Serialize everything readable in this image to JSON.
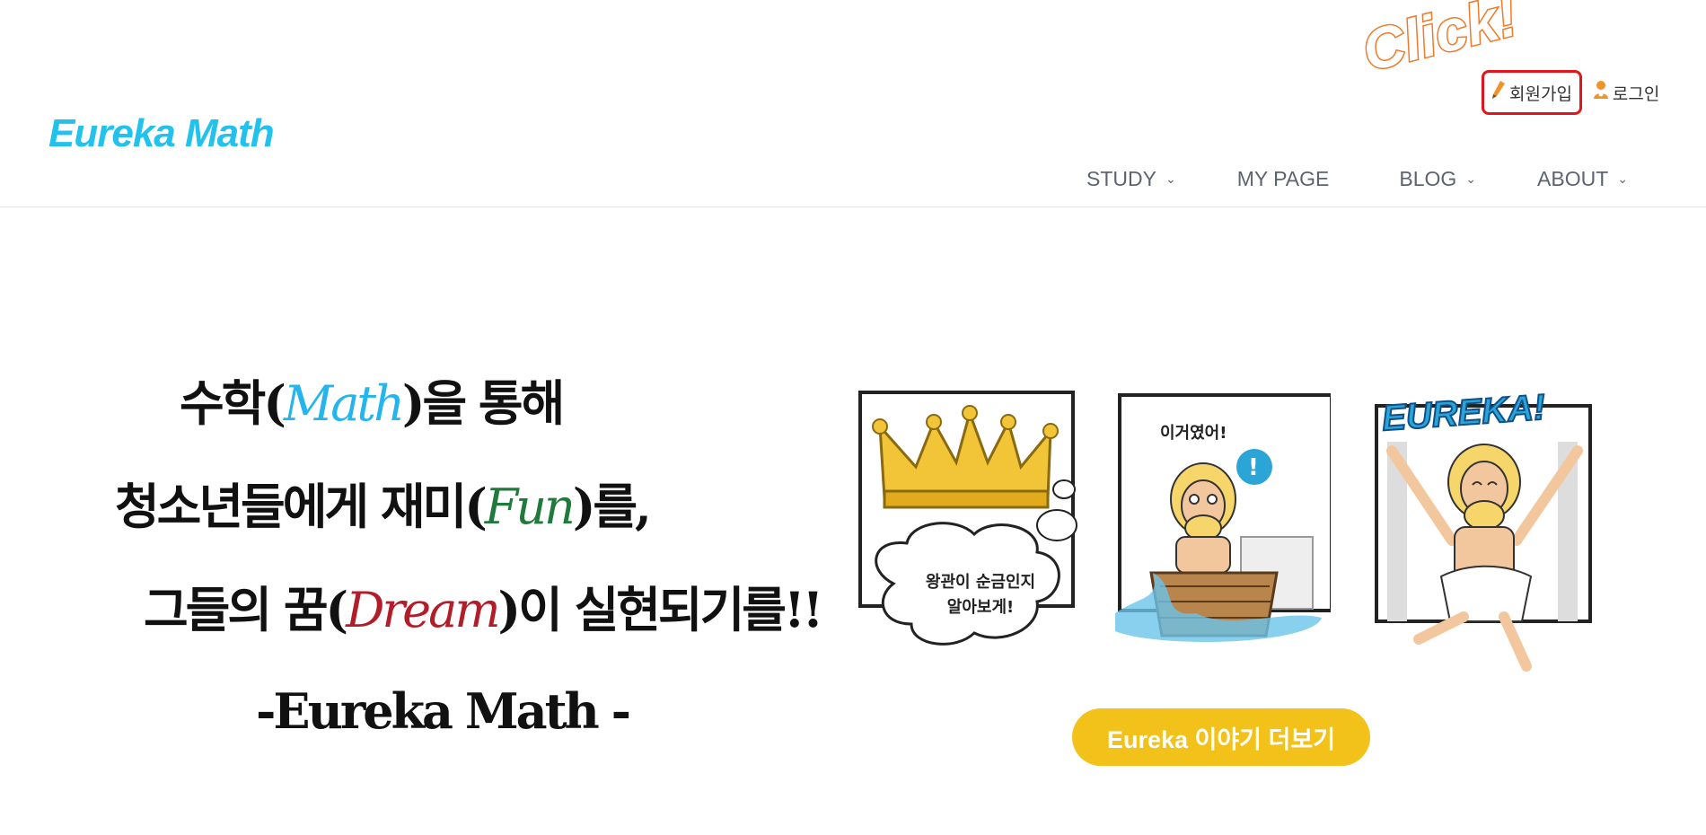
{
  "header": {
    "logo": "Eureka Math",
    "annotation": "Click!",
    "top_links": [
      {
        "label": "회원가입",
        "icon": "pencil-icon"
      },
      {
        "label": "로그인",
        "icon": "user-icon"
      }
    ],
    "nav": [
      {
        "label": "STUDY",
        "has_dropdown": true
      },
      {
        "label": "MY PAGE",
        "has_dropdown": false
      },
      {
        "label": "BLOG",
        "has_dropdown": true
      },
      {
        "label": "ABOUT",
        "has_dropdown": true
      }
    ],
    "chevron": "⌄"
  },
  "hero": {
    "line1": {
      "a": "수학(",
      "b": "Math",
      "c": ")을 통해"
    },
    "line2": {
      "a": "청소년들에게 재미(",
      "b": "Fun",
      "c": ")를,"
    },
    "line3": {
      "a": "그들의 꿈(",
      "b": "Dream",
      "c": ")이 실현되기를!!"
    },
    "line4": "-Eureka Math -"
  },
  "comic": {
    "bubble1": [
      "왕관이 순금인지",
      "알아보게!"
    ],
    "speech2": "이거였어!",
    "exclaim": "!",
    "banner3": "EUREKA!"
  },
  "cta": {
    "label": "Eureka 이야기 더보기"
  },
  "colors": {
    "accent": "#22c2ec",
    "cta": "#f3c21a",
    "highlight": "#e0161e",
    "annotation": "#f07a2a"
  }
}
